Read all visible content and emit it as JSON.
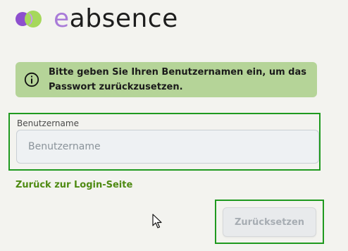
{
  "app": {
    "logo_prefix": "e",
    "logo_suffix": "absence"
  },
  "info": {
    "message": "Bitte geben Sie Ihren Benutzernamen ein, um das Passwort zurückzusetzen."
  },
  "form": {
    "username_label": "Benutzername",
    "username_placeholder": "Benutzername",
    "username_value": ""
  },
  "links": {
    "back_to_login": "Zurück zur Login-Seite"
  },
  "actions": {
    "reset_label": "Zurücksetzen"
  },
  "colors": {
    "info_background": "#b5d498",
    "link_green": "#4e8a12",
    "highlight_green": "#1f9a1f",
    "logo_purple": "#a97bd8"
  },
  "icons": {
    "logo": "eabsence-logo-icon",
    "info": "info-circle-icon",
    "cursor": "mouse-pointer-icon"
  }
}
